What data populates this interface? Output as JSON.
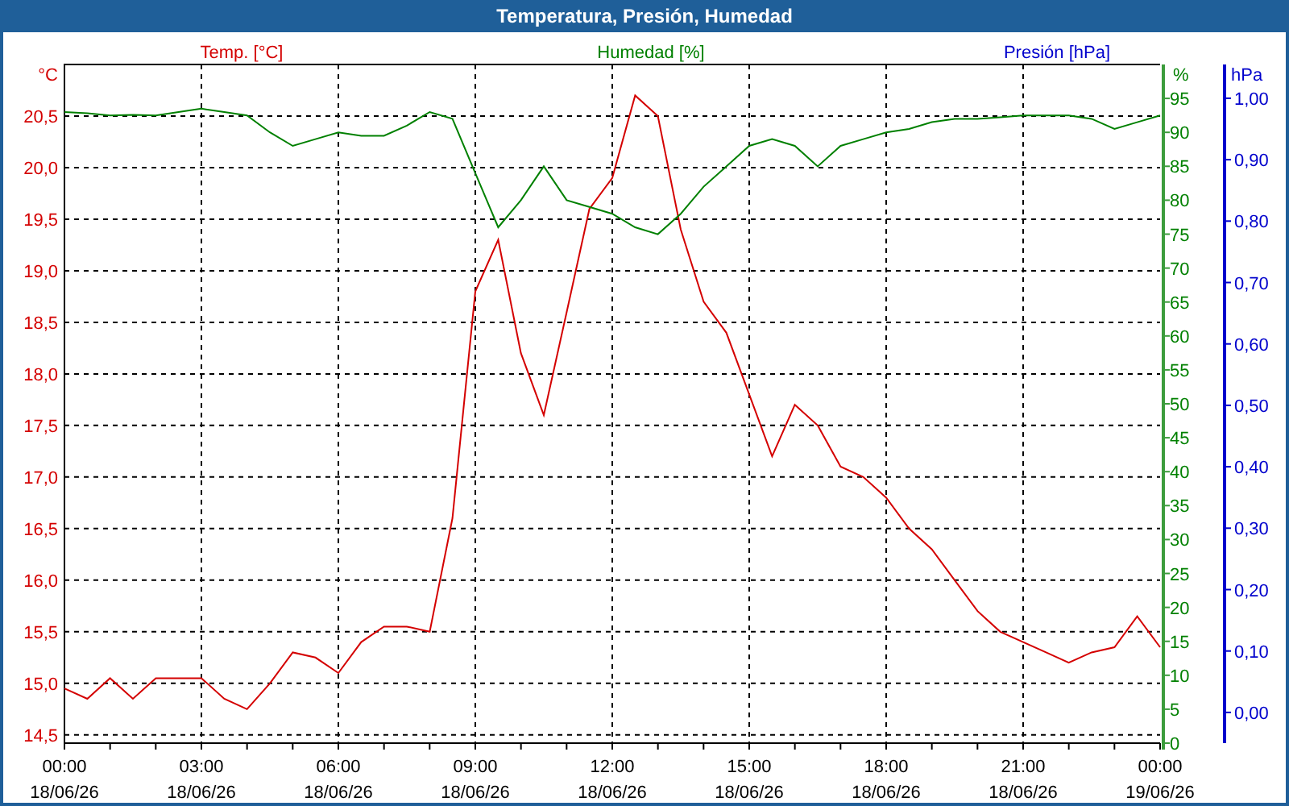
{
  "window": {
    "title": "Temperatura, Presión, Humedad"
  },
  "chart": {
    "pressure_title": "Presión [hPa]",
    "chart_data": {
      "type": "line",
      "grid": true,
      "ylabel": "°C",
      "y2label": "%",
      "y3label": "hPa",
      "categories": [
        "00:00\n18/06/26",
        null,
        null,
        null,
        null,
        null,
        "03:00\n18/06/26",
        null,
        null,
        null,
        null,
        null,
        "06:00\n18/06/26",
        null,
        null,
        null,
        null,
        null,
        "09:00\n18/06/26",
        null,
        null,
        null,
        null,
        null,
        "12:00\n18/06/26",
        null,
        null,
        null,
        null,
        null,
        "15:00\n18/06/26",
        null,
        null,
        null,
        null,
        null,
        "18:00\n18/06/26",
        null,
        null,
        null,
        null,
        null,
        "21:00\n18/06/26",
        null,
        null,
        null,
        null,
        null,
        "00:00\n19/06/26"
      ],
      "series": [
        {
          "name": "Temp. [°C]",
          "color": "#d40000",
          "axis": "y",
          "values": [
            14.95,
            14.85,
            15.05,
            14.85,
            15.05,
            15.05,
            15.05,
            14.85,
            14.75,
            15.0,
            15.3,
            15.25,
            15.1,
            15.4,
            15.55,
            15.55,
            15.5,
            16.6,
            18.8,
            19.3,
            18.2,
            17.6,
            18.6,
            19.6,
            19.9,
            20.7,
            20.5,
            19.4,
            18.7,
            18.4,
            17.8,
            17.2,
            17.7,
            17.5,
            17.1,
            17.0,
            16.8,
            16.5,
            16.3,
            16.0,
            15.7,
            15.5,
            15.4,
            15.3,
            15.2,
            15.3,
            15.35,
            15.65,
            15.35
          ]
        },
        {
          "name": "Humedad [%]",
          "color": "#008000",
          "axis": "y2",
          "values": [
            93,
            92.8,
            92.5,
            92.6,
            92.5,
            93,
            93.5,
            93,
            92.5,
            90,
            88,
            89,
            90,
            89.5,
            89.5,
            91,
            93,
            92,
            84,
            76,
            80,
            85,
            80,
            79,
            78,
            76,
            75,
            78,
            82,
            85,
            88,
            89,
            88,
            85,
            88,
            89,
            90,
            90.5,
            91.5,
            92,
            92,
            92.2,
            92.5,
            92.5,
            92.5,
            92,
            90.5,
            91.5,
            92.5
          ]
        }
      ],
      "ylim": [
        14.42,
        21.0
      ],
      "y2lim": [
        0,
        100
      ],
      "y3lim": [
        -0.05,
        1.055
      ],
      "yticks": [
        {
          "value": 14.5,
          "label": "14,5"
        },
        {
          "value": 15,
          "label": "15,0"
        },
        {
          "value": 15.5,
          "label": "15,5"
        },
        {
          "value": 16,
          "label": "16,0"
        },
        {
          "value": 16.5,
          "label": "16,5"
        },
        {
          "value": 17,
          "label": "17,0"
        },
        {
          "value": 17.5,
          "label": "17,5"
        },
        {
          "value": 18,
          "label": "18,0"
        },
        {
          "value": 18.5,
          "label": "18,5"
        },
        {
          "value": 19,
          "label": "19,0"
        },
        {
          "value": 19.5,
          "label": "19,5"
        },
        {
          "value": 20,
          "label": "20,0"
        },
        {
          "value": 20.5,
          "label": "20,5"
        }
      ],
      "y2ticks": [
        {
          "value": 0,
          "label": "0"
        },
        {
          "value": 5,
          "label": "5"
        },
        {
          "value": 10,
          "label": "10"
        },
        {
          "value": 15,
          "label": "15"
        },
        {
          "value": 20,
          "label": "20"
        },
        {
          "value": 25,
          "label": "25"
        },
        {
          "value": 30,
          "label": "30"
        },
        {
          "value": 35,
          "label": "35"
        },
        {
          "value": 40,
          "label": "40"
        },
        {
          "value": 45,
          "label": "45"
        },
        {
          "value": 50,
          "label": "50"
        },
        {
          "value": 55,
          "label": "55"
        },
        {
          "value": 60,
          "label": "60"
        },
        {
          "value": 65,
          "label": "65"
        },
        {
          "value": 70,
          "label": "70"
        },
        {
          "value": 75,
          "label": "75"
        },
        {
          "value": 80,
          "label": "80"
        },
        {
          "value": 85,
          "label": "85"
        },
        {
          "value": 90,
          "label": "90"
        },
        {
          "value": 95,
          "label": "95"
        }
      ],
      "y3ticks": [
        {
          "value": 0,
          "label": "0,00"
        },
        {
          "value": 0.1,
          "label": "0,10"
        },
        {
          "value": 0.2,
          "label": "0,20"
        },
        {
          "value": 0.3,
          "label": "0,30"
        },
        {
          "value": 0.4,
          "label": "0,40"
        },
        {
          "value": 0.5,
          "label": "0,50"
        },
        {
          "value": 0.6,
          "label": "0,60"
        },
        {
          "value": 0.7,
          "label": "0,70"
        },
        {
          "value": 0.8,
          "label": "0,80"
        },
        {
          "value": 0.9,
          "label": "0,90"
        },
        {
          "value": 1.0,
          "label": "1,00"
        }
      ]
    }
  }
}
